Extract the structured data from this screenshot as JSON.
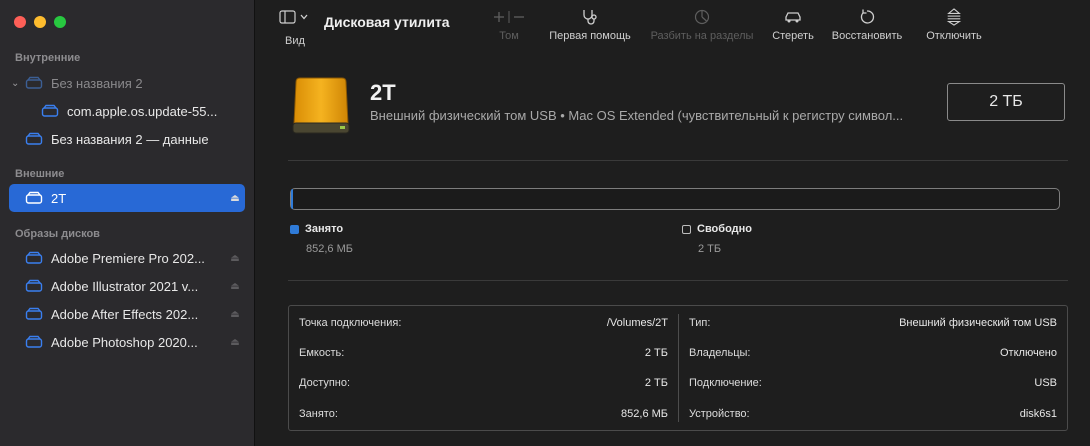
{
  "sidebar": {
    "sections": {
      "internal": "Внутренние",
      "external": "Внешние",
      "images": "Образы дисков"
    },
    "internal_items": [
      {
        "label": "Без названия 2",
        "dim": true
      },
      {
        "label": "com.apple.os.update-55..."
      },
      {
        "label": "Без названия 2 — данные"
      }
    ],
    "external_items": [
      {
        "label": "2T"
      }
    ],
    "image_items": [
      {
        "label": "Adobe Premiere Pro 202..."
      },
      {
        "label": "Adobe Illustrator 2021 v..."
      },
      {
        "label": "Adobe After Effects 202..."
      },
      {
        "label": "Adobe Photoshop 2020..."
      }
    ]
  },
  "toolbar": {
    "view_label": "Вид",
    "title": "Дисковая утилита",
    "volume_label": "Том",
    "first_aid_label": "Первая помощь",
    "partition_label": "Разбить на разделы",
    "erase_label": "Стереть",
    "restore_label": "Восстановить",
    "unmount_label": "Отключить"
  },
  "disk": {
    "name": "2T",
    "description": "Внешний физический том USB • Mac OS Extended (чувствительный к регистру символ...",
    "size": "2 ТБ"
  },
  "usage": {
    "used_label": "Занято",
    "used_value": "852,6 МБ",
    "used_fraction": 0.0004,
    "free_label": "Свободно",
    "free_value": "2 ТБ",
    "used_color": "#2f7bd8"
  },
  "info": {
    "left": [
      {
        "k": "Точка подключения:",
        "v": "/Volumes/2T"
      },
      {
        "k": "Емкость:",
        "v": "2 ТБ"
      },
      {
        "k": "Доступно:",
        "v": "2 ТБ"
      },
      {
        "k": "Занято:",
        "v": "852,6 МБ"
      }
    ],
    "right": [
      {
        "k": "Тип:",
        "v": "Внешний физический том USB"
      },
      {
        "k": "Владельцы:",
        "v": "Отключено"
      },
      {
        "k": "Подключение:",
        "v": "USB"
      },
      {
        "k": "Устройство:",
        "v": "disk6s1"
      }
    ]
  }
}
